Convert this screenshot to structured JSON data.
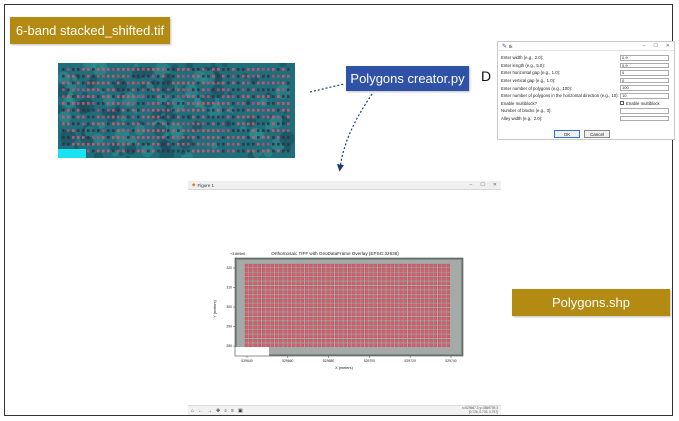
{
  "labels": {
    "input_file": "6-band stacked_shifted.tif",
    "script": "Polygons creator.py",
    "output_file": "Polygons.shp",
    "step_marker": "D"
  },
  "dialog": {
    "title": "tk",
    "fields": [
      {
        "label": "Enter width (e.g., 2.0):",
        "value": "0.9"
      },
      {
        "label": "Enter length (e.g., 5.0):",
        "value": "0.9"
      },
      {
        "label": "Enter horizontal gap (e.g., 1.0):",
        "value": "0"
      },
      {
        "label": "Enter vertical gap (e.g., 1.0):",
        "value": "0"
      },
      {
        "label": "Enter number of polygons (e.g., 100):",
        "value": "100"
      },
      {
        "label": "Enter number of polygons in the horizontal direction (e.g., 10):",
        "value": "10"
      }
    ],
    "multiblock_label": "Enable multiblock?",
    "multiblock_checkbox_label": "Enable multiblock",
    "blocks_label": "Number of blocks (e.g., 3):",
    "alley_label": "Alley width (e.g., 2.0):",
    "ok_label": "OK",
    "cancel_label": "Cancel"
  },
  "figure_window": {
    "title": "Figure 1",
    "toolbar_icons": [
      "home-icon",
      "back-icon",
      "forward-icon",
      "pan-icon",
      "zoom-icon",
      "configure-icon",
      "save-icon"
    ],
    "coords_line1": "x=529667.3 y=3869739.3",
    "coords_line2": "[0.726, 0.733, 0.757]"
  },
  "colors": {
    "gold_tag": "#b38a12",
    "blue_tag": "#2f52a6",
    "plot_polygon": "#e05a6a",
    "ortho_base": "#1e6f7a"
  },
  "chart_data": {
    "type": "scatter",
    "title": "Orthomosaic TIFF with GeoDataFrame Overlay (EPSG:32636)",
    "xlabel": "X (meters)",
    "ylabel": "Y (meters)",
    "offset_label": "+3.869e6",
    "x_ticks": [
      "529640",
      "529660",
      "529680",
      "529700",
      "529720",
      "529740"
    ],
    "y_ticks": [
      "320",
      "310",
      "300",
      "290",
      "280"
    ],
    "grid": false,
    "polygon_columns": 48,
    "polygon_rows": 19
  }
}
